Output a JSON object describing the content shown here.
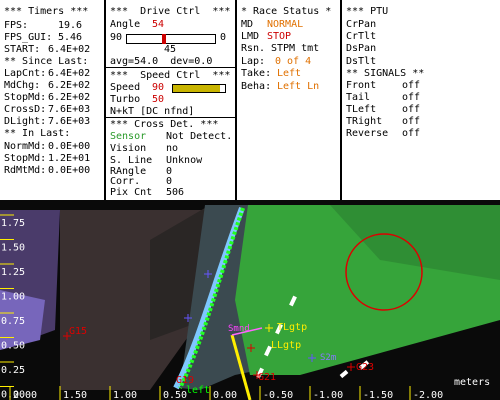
{
  "timers": {
    "header": "*** Timers ***",
    "fps_label": "FPS:",
    "fps_value": "19.6",
    "fps_gui_label": "FPS_GUI:",
    "fps_gui_value": "5.46",
    "start_label": "START:",
    "start_value": "6.4E+02",
    "since_last_header": "** Since Last:",
    "lapcnt_label": "LapCnt:",
    "lapcnt_value": "6.4E+02",
    "mdchg_label": "MdChg:",
    "mdchg_value": "6.2E+02",
    "stopmd_label": "StopMd:",
    "stopmd_value": "6.2E+02",
    "crossd_label": "CrossD:",
    "crossd_value": "7.6E+03",
    "dlight_label": "DLight:",
    "dlight_value": "7.6E+03",
    "in_last_header": "** In Last:",
    "normmd_label": "NormMd:",
    "normmd_value": "0.0E+00",
    "stopmd2_label": "StopMd:",
    "stopmd2_value": "1.2E+01",
    "rdmtmd_label": "RdMtMd:",
    "rdmtmd_value": "0.0E+00"
  },
  "drive": {
    "header": "***  Drive Ctrl  ***",
    "angle_label": "Angle",
    "angle_value": "54",
    "range_min": "90",
    "range_max": "0",
    "slider_mid": "45",
    "slider_level": 0.4,
    "avg_line": "avg=54.0  dev=0.0",
    "speed_header": "***  Speed Ctrl  ***",
    "speed_label": "Speed",
    "speed_value": "90",
    "turbo_label": "Turbo",
    "turbo_value": "50",
    "speed_level": 0.9,
    "nkt_line": "N+kT [DC nfnd]",
    "cross_header": "*** Cross Det. ***",
    "sensor_label": "Sensor",
    "sensor_value": "Not Detect.",
    "vision_label": "Vision",
    "vision_value": "no",
    "sline_label": "S. Line",
    "sline_value": "Unknow",
    "rangle_label": "RAngle",
    "rangle_value": "0",
    "corr_label": "Corr.",
    "corr_value": "0",
    "pixcnt_label": "Pix Cnt",
    "pixcnt_value": "506"
  },
  "race": {
    "header": "* Race Status *",
    "md_label": "MD",
    "md_value": "NORMAL",
    "lmd_label": "LMD",
    "lmd_value": "STOP",
    "rsn_label": "Rsn.",
    "rsn_value": "STPM tmt",
    "lap_label": "Lap:",
    "lap_value": "0 of 4",
    "take_label": "Take:",
    "take_value": "Left",
    "beha_label": "Beha:",
    "beha_value": "Left Ln"
  },
  "ptu": {
    "header": "*** PTU",
    "items": [
      "CrPan",
      "CrTlt",
      "DsPan",
      "DsTlt"
    ],
    "signals_header": "** SIGNALS **",
    "signals": [
      {
        "label": "Front",
        "value": "off"
      },
      {
        "label": "Tail",
        "value": "off"
      },
      {
        "label": "TLeft",
        "value": "off"
      },
      {
        "label": "TRight",
        "value": "off"
      },
      {
        "label": "Reverse",
        "value": "off"
      }
    ]
  },
  "view": {
    "y_ticks": [
      "1.75",
      "1.50",
      "1.25",
      "1.00",
      "0.75",
      "0.50",
      "0.25",
      "0.00"
    ],
    "x_ticks": [
      "2.00",
      "1.50",
      "1.00",
      "0.50",
      "0.00",
      "-0.50",
      "-1.00",
      "-1.50",
      "-2.00"
    ],
    "units": "meters",
    "markers": {
      "g15": "G15",
      "tlgtp": "TLgtp",
      "llgtp": "LLgtp",
      "smnd": "Smnd",
      "sm2": "S2m",
      "g19": "G19",
      "left": "left",
      "g21": "G21",
      "g23": "G23"
    },
    "colors": {
      "accent": "#cc0000",
      "highlight": "#e07000",
      "ok": "#2a9a2a",
      "grass": "#3ca83c",
      "cone": "#00ff00"
    }
  }
}
